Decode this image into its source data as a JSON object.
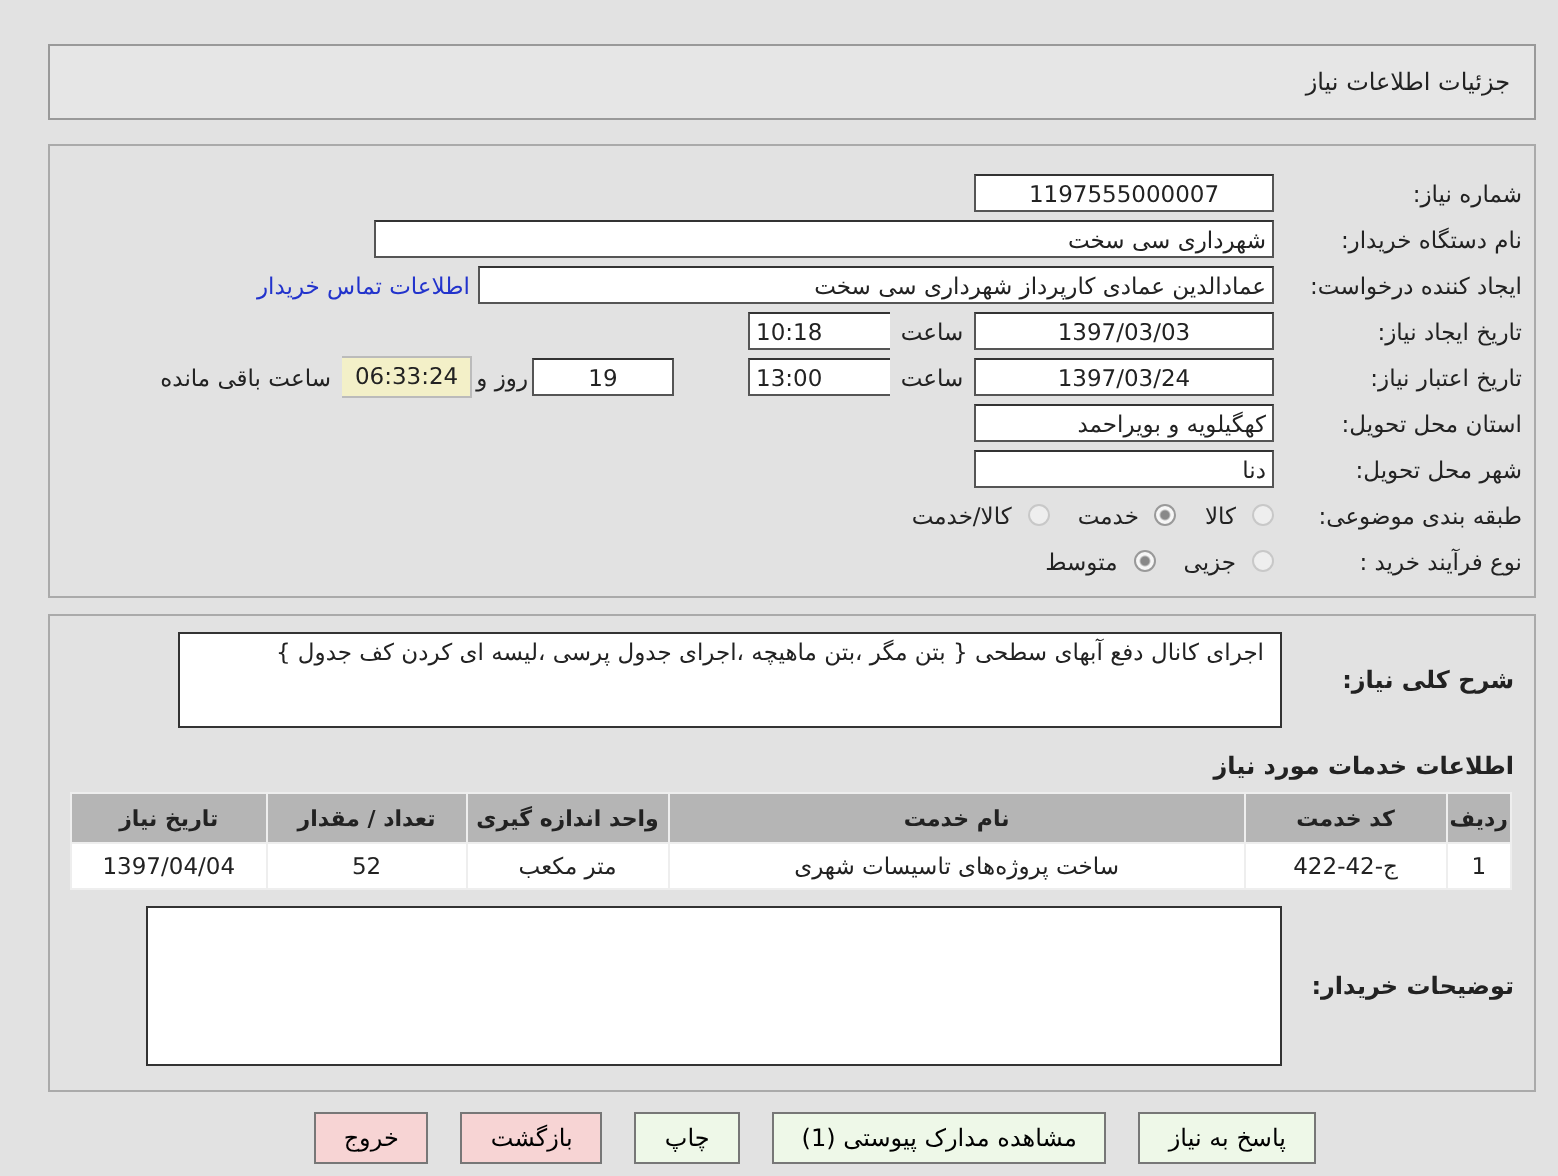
{
  "header": {
    "title": "جزئیات اطلاعات نیاز"
  },
  "fields": [
    {
      "kind": "number",
      "label": "شماره نیاز:",
      "value": "1197555000007"
    },
    {
      "kind": "wide",
      "label": "نام دستگاه خریدار:",
      "value": "شهرداری سی سخت"
    },
    {
      "kind": "contact",
      "label": "ایجاد کننده درخواست:",
      "value": "عمادالدین عمادی کارپرداز شهرداری سی سخت",
      "link": "اطلاعات تماس خریدار"
    },
    {
      "kind": "datetime",
      "label": "تاریخ ایجاد نیاز:",
      "value": "1397/03/03",
      "time_label": "ساعت",
      "time": "10:18"
    },
    {
      "kind": "deadline",
      "label": "تاریخ اعتبار نیاز:",
      "value": "1397/03/24",
      "time_label": "ساعت",
      "time": "13:00",
      "days": "19",
      "days_label": "روز و",
      "remaining": "06:33:24",
      "remaining_label": "ساعت باقی مانده"
    },
    {
      "kind": "short",
      "label": "استان محل تحویل:",
      "value": "کهگیلویه و بویراحمد"
    },
    {
      "kind": "short",
      "label": "شهر محل تحویل:",
      "value": "دنا"
    },
    {
      "kind": "choice",
      "label": "طبقه بندی موضوعی:",
      "options": [
        {
          "label": "کالا",
          "selected": false
        },
        {
          "label": "خدمت",
          "selected": true
        },
        {
          "label": "کالا/خدمت",
          "selected": false
        }
      ]
    },
    {
      "kind": "choice",
      "label": "نوع فرآیند خرید :",
      "options": [
        {
          "label": "جزیی",
          "selected": false
        },
        {
          "label": "متوسط",
          "selected": true
        }
      ]
    }
  ],
  "description": {
    "label": "شرح کلی نیاز:",
    "value": "اجرای کانال دفع آبهای سطحی { بتن مگر ،بتن ماهیچه ،اجرای جدول پرسی ،لیسه ای کردن کف جدول }"
  },
  "services": {
    "title": "اطلاعات خدمات مورد نیاز",
    "columns": [
      "ردیف",
      "کد خدمت",
      "نام خدمت",
      "واحد اندازه گیری",
      "تعداد / مقدار",
      "تاریخ نیاز"
    ],
    "rows": [
      [
        "1",
        "ج-42-422",
        "ساخت پروژه‌های تاسیسات شهری",
        "متر مکعب",
        "52",
        "1397/04/04"
      ]
    ]
  },
  "notes": {
    "label": "توضیحات خریدار:"
  },
  "buttons": [
    {
      "label": "پاسخ به نیاز",
      "kind": "normal"
    },
    {
      "label": "مشاهده مدارک پیوستی (1)",
      "kind": "normal"
    },
    {
      "label": "چاپ",
      "kind": "normal"
    },
    {
      "label": "بازگشت",
      "kind": "danger"
    },
    {
      "label": "خروج",
      "kind": "danger"
    }
  ]
}
